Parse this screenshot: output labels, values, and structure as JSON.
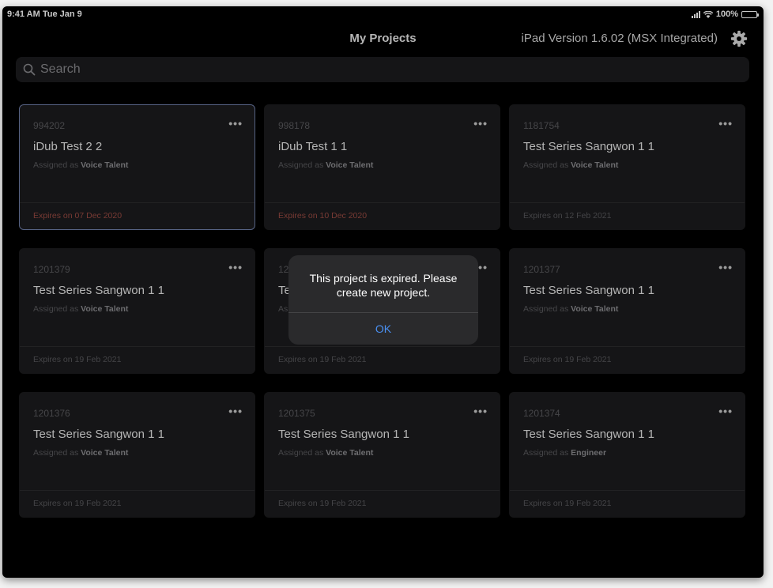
{
  "status_bar": {
    "time_date": "9:41 AM  Tue Jan 9",
    "battery": "100%"
  },
  "header": {
    "title": "My Projects",
    "version": "iPad Version 1.6.02 (MSX Integrated)"
  },
  "search": {
    "placeholder": "Search"
  },
  "assigned_prefix": "Assigned as",
  "projects": [
    {
      "id": "994202",
      "title": "iDub Test 2 2",
      "role": "Voice Talent",
      "expires": "Expires on 07 Dec 2020"
    },
    {
      "id": "998178",
      "title": "iDub Test 1 1",
      "role": "Voice Talent",
      "expires": "Expires on 10 Dec 2020"
    },
    {
      "id": "1181754",
      "title": "Test Series Sangwon 1 1",
      "role": "Voice Talent",
      "expires": "Expires on 12 Feb 2021"
    },
    {
      "id": "1201379",
      "title": "Test Series Sangwon 1 1",
      "role": "Voice Talent",
      "expires": "Expires on 19 Feb 2021"
    },
    {
      "id": "12",
      "title": "Te",
      "role": "",
      "expires": "Expires on 19 Feb 2021"
    },
    {
      "id": "1201377",
      "title": "Test Series Sangwon 1 1",
      "role": "Voice Talent",
      "expires": "Expires on 19 Feb 2021"
    },
    {
      "id": "1201376",
      "title": "Test Series Sangwon 1 1",
      "role": "Voice Talent",
      "expires": "Expires on 19 Feb 2021"
    },
    {
      "id": "1201375",
      "title": "Test Series Sangwon 1 1",
      "role": "Voice Talent",
      "expires": "Expires on 19 Feb 2021"
    },
    {
      "id": "1201374",
      "title": "Test Series Sangwon 1 1",
      "role": "Engineer",
      "expires": "Expires on 19 Feb 2021"
    }
  ],
  "alert": {
    "message": "This project is expired. Please create new project.",
    "ok_label": "OK"
  },
  "colors": {
    "accent": "#4a90f2",
    "expired_text": "#9a4b43",
    "selected_border": "#6f7ea8"
  }
}
